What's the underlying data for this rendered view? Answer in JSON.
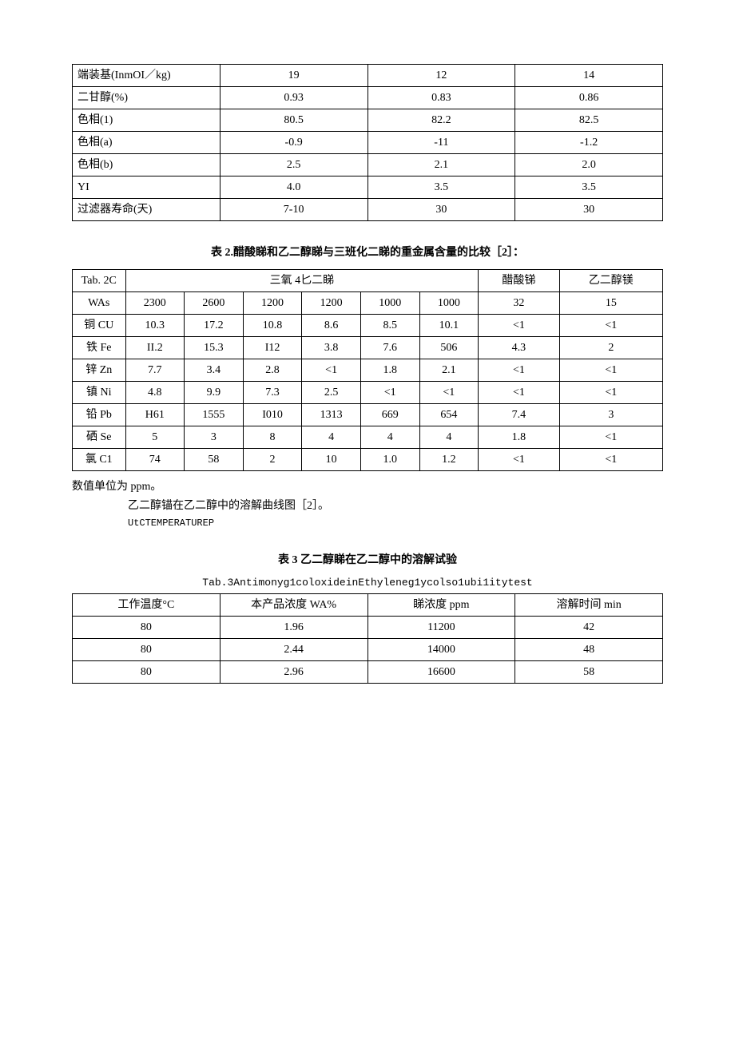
{
  "table1": {
    "rows": [
      {
        "label": "端装基(InmOI／kg)",
        "c1": "19",
        "c2": "12",
        "c3": "14"
      },
      {
        "label": "二甘醇(%)",
        "c1": "0.93",
        "c2": "0.83",
        "c3": "0.86"
      },
      {
        "label": "色相(1)",
        "c1": "80.5",
        "c2": "82.2",
        "c3": "82.5"
      },
      {
        "label": "色相(a)",
        "c1": "-0.9",
        "c2": "-11",
        "c3": "-1.2"
      },
      {
        "label": "色相(b)",
        "c1": "2.5",
        "c2": "2.1",
        "c3": "2.0"
      },
      {
        "label": "YI",
        "c1": "4.0",
        "c2": "3.5",
        "c3": "3.5"
      },
      {
        "label": "过滤器寿命(天)",
        "c1": "7-10",
        "c2": "30",
        "c3": "30"
      }
    ]
  },
  "table2_title": "表 2.醋酸睇和乙二醇睇与三班化二睇的重金属含量的比较［2］：",
  "table2": {
    "header": {
      "c0": "Tab. 2C",
      "span": "三氧 4匕二睇",
      "c7": "醋酸锑",
      "c8": "乙二醇镁"
    },
    "rows": [
      {
        "c0": "WAs",
        "c1": "2300",
        "c2": "2600",
        "c3": "1200",
        "c4": "1200",
        "c5": "1000",
        "c6": "1000",
        "c7": "32",
        "c8": "15"
      },
      {
        "c0": "铜 CU",
        "c1": "10.3",
        "c2": "17.2",
        "c3": "10.8",
        "c4": "8.6",
        "c5": "8.5",
        "c6": "10.1",
        "c7": "<1",
        "c8": "<1"
      },
      {
        "c0": "铁 Fe",
        "c1": "II.2",
        "c2": "15.3",
        "c3": "I12",
        "c4": "3.8",
        "c5": "7.6",
        "c6": "506",
        "c7": "4.3",
        "c8": "2"
      },
      {
        "c0": "锌 Zn",
        "c1": "7.7",
        "c2": "3.4",
        "c3": "2.8",
        "c4": "<1",
        "c5": "1.8",
        "c6": "2.1",
        "c7": "<1",
        "c8": "<1"
      },
      {
        "c0": "镇 Ni",
        "c1": "4.8",
        "c2": "9.9",
        "c3": "7.3",
        "c4": "2.5",
        "c5": "<1",
        "c6": "<1",
        "c7": "<1",
        "c8": "<1"
      },
      {
        "c0": "铅 Pb",
        "c1": "H61",
        "c2": "1555",
        "c3": "I010",
        "c4": "1313",
        "c5": "669",
        "c6": "654",
        "c7": "7.4",
        "c8": "3"
      },
      {
        "c0": "硒 Se",
        "c1": "5",
        "c2": "3",
        "c3": "8",
        "c4": "4",
        "c5": "4",
        "c6": "4",
        "c7": "1.8",
        "c8": "<1"
      },
      {
        "c0": "氯 C1",
        "c1": "74",
        "c2": "58",
        "c3": "2",
        "c4": "10",
        "c5": "1.0",
        "c6": "1.2",
        "c7": "<1",
        "c8": "<1"
      }
    ]
  },
  "note_unit": "数值单位为 ppm。",
  "curve_caption": "乙二醇锚在乙二醇中的溶解曲线图［2］。",
  "temp_label": "UtCTEMPERATUREP",
  "table3_title": "表 3 乙二醇睇在乙二醇中的溶解试验",
  "table3_sub": "Tab.3Antimonyg1coloxideinEthyleneg1ycolso1ubi1itytest",
  "table3": {
    "header": {
      "c0": "工作温度°C",
      "c1": "本产品浓度 WA%",
      "c2": "睇浓度 ppm",
      "c3": "溶解时间 min"
    },
    "rows": [
      {
        "c0": "80",
        "c1": "1.96",
        "c2": "11200",
        "c3": "42"
      },
      {
        "c0": "80",
        "c1": "2.44",
        "c2": "14000",
        "c3": "48"
      },
      {
        "c0": "80",
        "c1": "2.96",
        "c2": "16600",
        "c3": "58"
      }
    ]
  }
}
